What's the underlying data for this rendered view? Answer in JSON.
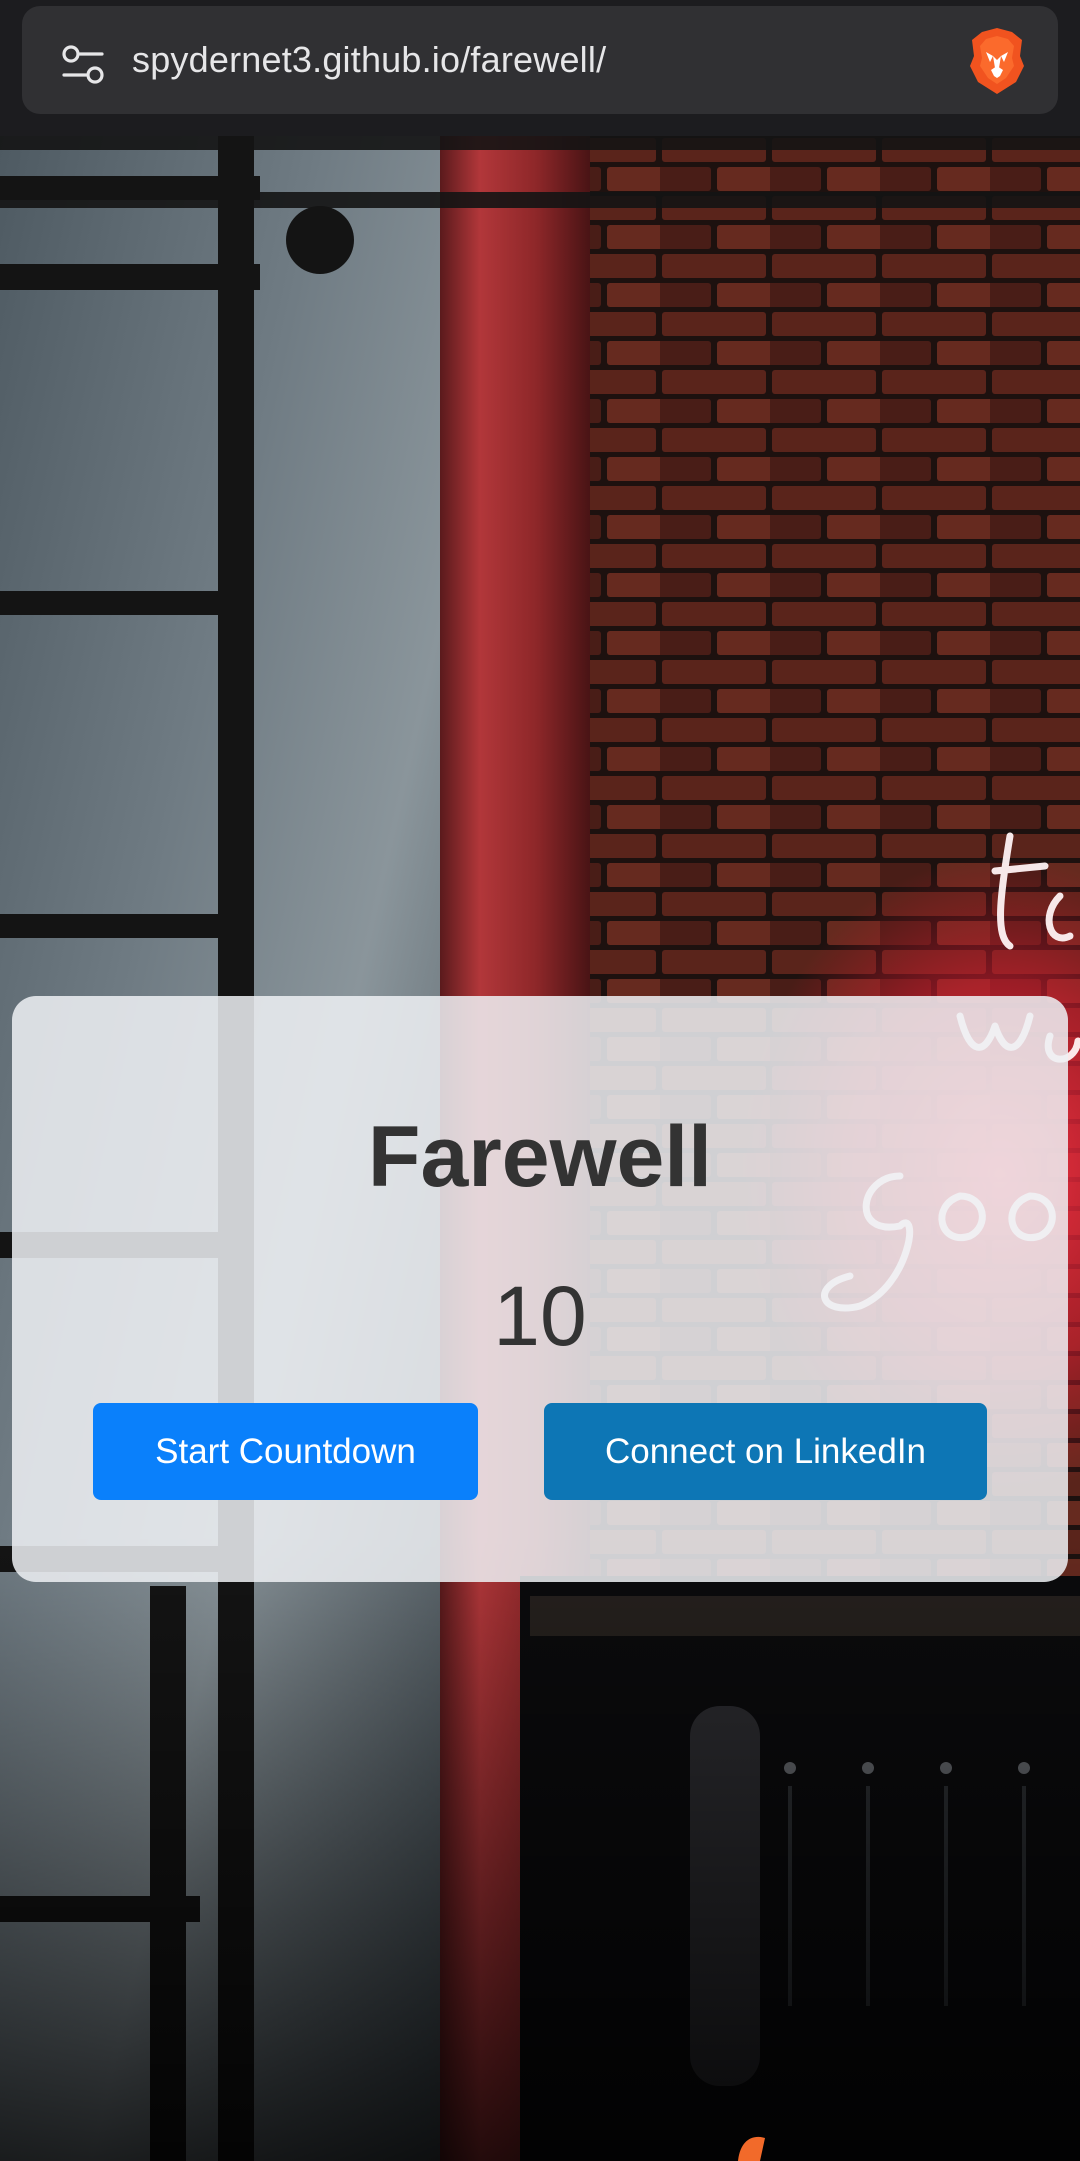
{
  "browser": {
    "url": "spydernet3.github.io/farewell/",
    "left_icon": "site-settings-icon",
    "right_icon": "brave-lion-icon"
  },
  "card": {
    "title": "Farewell",
    "countdown_value": "10",
    "buttons": {
      "start_label": "Start Countdown",
      "linkedin_label": "Connect on LinkedIn"
    }
  },
  "colors": {
    "start_button": "#0a80fb",
    "linkedin_button": "#0d76b5",
    "card_text": "#333333",
    "browser_bar": "#1c1c1f"
  }
}
